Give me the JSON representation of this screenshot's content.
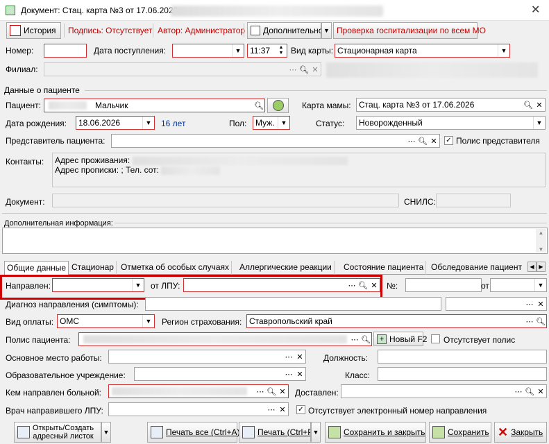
{
  "window": {
    "title": "Документ: Стац. карта №3 от 17.06.2026",
    "close_glyph": "✕"
  },
  "toolbar": {
    "history_label": "История",
    "signature_label": "Подпись: Отсутствует",
    "author_label": "Автор: Администратор",
    "additional_label": "Дополнительно",
    "hospitalization_check_label": "Проверка госпитализации по всем МО"
  },
  "header": {
    "number_label": "Номер:",
    "number_value": "",
    "admission_date_label": "Дата поступления:",
    "admission_date_value": "",
    "admission_time_value": "11:37",
    "card_type_label": "Вид карты:",
    "card_type_value": "Стационарная карта",
    "branch_label": "Филиал:",
    "branch_value": ""
  },
  "patient": {
    "section_title": "Данные о пациенте",
    "patient_label": "Пациент:",
    "patient_value": "Мальчик",
    "mother_card_label": "Карта мамы:",
    "mother_card_value": "Стац. карта №3 от 17.06.2026",
    "birth_date_label": "Дата рождения:",
    "birth_date_value": "18.06.2026",
    "age_text": "16 лет",
    "sex_label": "Пол:",
    "sex_value": "Муж.",
    "status_label": "Статус:",
    "status_value": "Новорожденный",
    "representative_label": "Представитель пациента:",
    "representative_value": "",
    "representative_policy_label": "Полис представителя",
    "contacts_label": "Контакты:",
    "contacts_line1": "Адрес проживания:",
    "contacts_line2": "Адрес прописки: ; Тел. сот:",
    "document_label": "Документ:",
    "snils_label": "СНИЛС:"
  },
  "extra_info": {
    "title": "Дополнительная информация:"
  },
  "tabs": [
    {
      "label": "Общие данные",
      "active": true
    },
    {
      "label": "Стационар"
    },
    {
      "label": "Отметка об особых случаях"
    },
    {
      "label": "Аллергические реакции"
    },
    {
      "label": "Состояние пациента"
    },
    {
      "label": "Обследование пациент"
    }
  ],
  "general": {
    "referral_label": "Направлен:",
    "referral_value": "",
    "from_lpu_label": "от ЛПУ:",
    "from_lpu_value": "",
    "number_label": "№:",
    "number_value": "",
    "from_label": "от",
    "from_value": "",
    "diagnosis_label": "Диагноз направления (симптомы):",
    "payment_label": "Вид оплаты:",
    "payment_value": "ОМС",
    "insurance_region_label": "Регион страхования:",
    "insurance_region_value": "Ставропольский край",
    "policy_label": "Полис пациента:",
    "new_policy_label": "Новый F2",
    "no_policy_label": "Отсутствует полис",
    "workplace_label": "Основное место работы:",
    "position_label": "Должность:",
    "school_label": "Образовательное учреждение:",
    "class_label": "Класс:",
    "referred_by_label": "Кем направлен больной:",
    "delivered_label": "Доставлен:",
    "doctor_label": "Врач направившего ЛПУ:",
    "no_e_referral_label": "Отсутствует электронный номер направления"
  },
  "footer": {
    "open_address_line1": "Открыть/Создать",
    "open_address_line2": "адресный листок",
    "print_all_label": "Печать все (Ctrl+A)",
    "print_label": "Печать (Ctrl+P)",
    "save_close_label": "Сохранить и закрыть",
    "save_label": "Сохранить",
    "close_label": "Закрыть"
  }
}
